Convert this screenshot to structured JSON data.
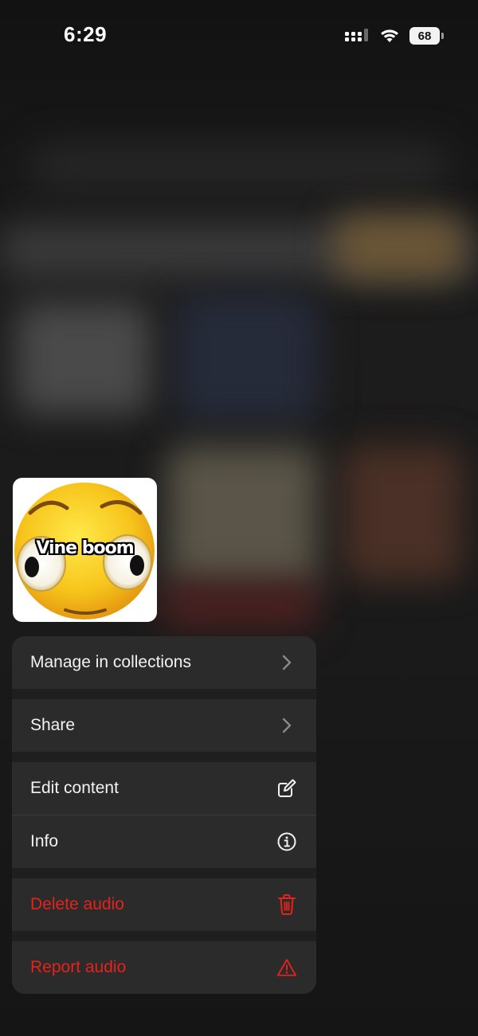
{
  "status_bar": {
    "time": "6:29",
    "battery_level": "68",
    "icons": [
      "cellular-signal-icon",
      "wifi-icon",
      "battery-icon"
    ]
  },
  "preview": {
    "thumbnail_label": "Vine boom",
    "thumbnail_image": "surprised-emoji-face"
  },
  "menu": {
    "items": [
      {
        "label": "Manage in collections",
        "icon": "chevron-right-icon",
        "destructive": false
      },
      {
        "label": "Share",
        "icon": "chevron-right-icon",
        "destructive": false
      },
      {
        "label": "Edit content",
        "icon": "edit-icon",
        "destructive": false
      },
      {
        "label": "Info",
        "icon": "info-icon",
        "destructive": false
      },
      {
        "label": "Delete audio",
        "icon": "trash-icon",
        "destructive": true
      },
      {
        "label": "Report audio",
        "icon": "warning-icon",
        "destructive": true
      }
    ]
  },
  "colors": {
    "destructive": "#e5221c",
    "menu_background": "#2b2b2b",
    "text_primary": "#f2f2f2"
  }
}
